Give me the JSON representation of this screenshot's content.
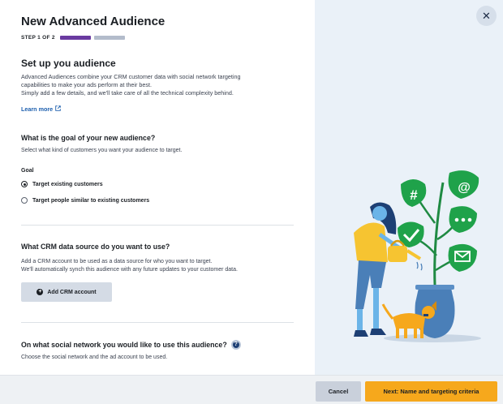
{
  "header": {
    "title": "New Advanced Audience",
    "step_label": "STEP 1 OF 2",
    "progress": {
      "current_step": 1,
      "total_steps": 2
    }
  },
  "setup": {
    "heading": "Set up you audience",
    "description_lines": [
      "Advanced Audiences combine your CRM customer data with social network targeting",
      "capabilities to make your ads perform at their best.",
      "Simply add a few details, and we'll take care of all the technical complexity behind."
    ],
    "learn_more": "Learn more"
  },
  "goal_section": {
    "heading": "What is the goal of your new audience?",
    "subtitle": "Select what kind of customers you want your audience to target.",
    "field_label": "Goal",
    "options": [
      {
        "label": "Target existing customers",
        "selected": true
      },
      {
        "label": "Target people similar to existing customers",
        "selected": false
      }
    ]
  },
  "crm_section": {
    "heading": "What CRM data source do you want to use?",
    "description_lines": [
      "Add a CRM account to be used as a data source for who you want to target.",
      "We'll automatically synch this audience with any future updates to your customer data."
    ],
    "add_button": "Add CRM account"
  },
  "social_section": {
    "heading": "On what social network you would like to use this audience?",
    "subtitle": "Choose the social network and the ad account to be used."
  },
  "footer": {
    "cancel": "Cancel",
    "next": "Next: Name and targeting criteria"
  },
  "illustration": {
    "icons": [
      "hashtag-icon",
      "at-sign-icon",
      "checkmark-icon",
      "chat-dots-icon",
      "envelope-icon"
    ]
  },
  "colors": {
    "accent_purple": "#6a3aa0",
    "primary_orange": "#f6a81c",
    "link_blue": "#1d5fae",
    "leaf_green": "#1fa24a",
    "panel_bg": "#eaf1f8"
  }
}
